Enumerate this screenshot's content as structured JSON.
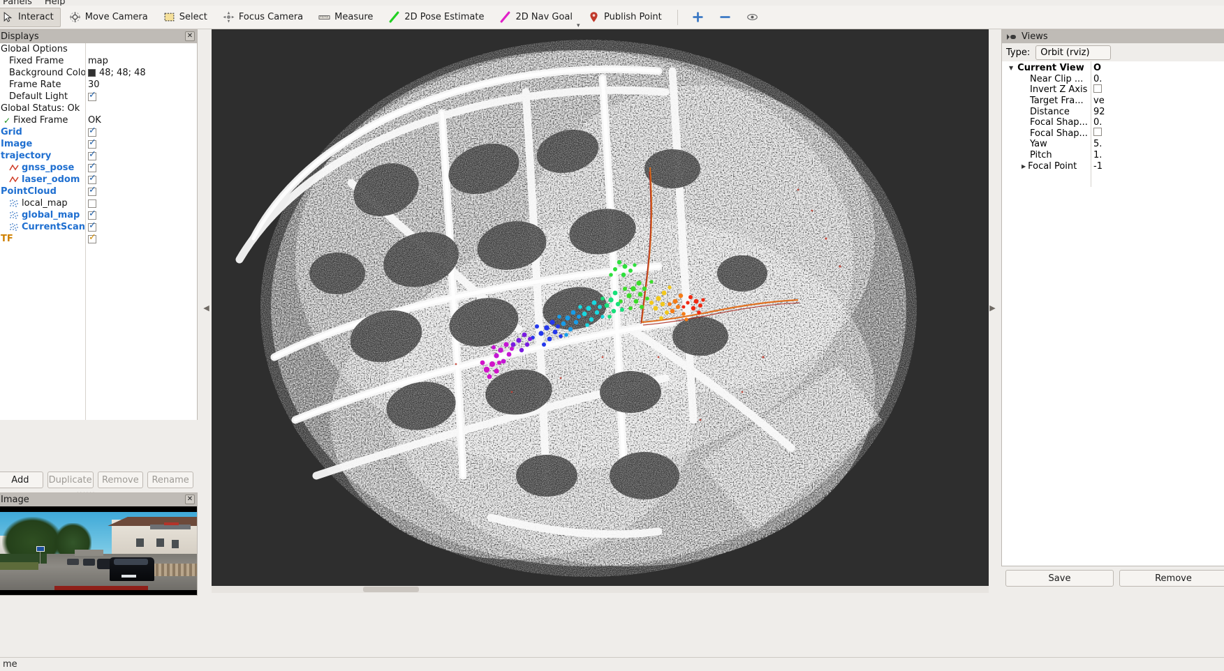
{
  "window": {
    "app": "rviz",
    "menus": [
      {
        "label": "Panels"
      },
      {
        "label": "Help"
      }
    ]
  },
  "toolbar": {
    "items": [
      {
        "label": "Interact",
        "icon": "cursor-icon",
        "active": true
      },
      {
        "label": "Move Camera",
        "icon": "move-camera-icon",
        "active": false
      },
      {
        "label": "Select",
        "icon": "select-icon",
        "active": false
      },
      {
        "label": "Focus Camera",
        "icon": "focus-camera-icon",
        "active": false
      },
      {
        "label": "Measure",
        "icon": "ruler-icon",
        "active": false
      },
      {
        "label": "2D Pose Estimate",
        "icon": "pose-estimate-icon",
        "active": false
      },
      {
        "label": "2D Nav Goal",
        "icon": "nav-goal-icon",
        "active": false
      },
      {
        "label": "Publish Point",
        "icon": "map-pin-icon",
        "active": false
      }
    ],
    "add_tool_label": "+",
    "remove_tool_label": "−",
    "overflow_label": "▾",
    "extra_tool_icon": "eye-icon"
  },
  "displays": {
    "title": "Displays",
    "close_label": "✕",
    "rows": [
      {
        "name": "Global Options",
        "level": 1,
        "style": "plain",
        "value_type": "none"
      },
      {
        "name": "Fixed Frame",
        "level": 2,
        "style": "plain",
        "value_type": "text",
        "value": "map"
      },
      {
        "name": "Background Color",
        "level": 2,
        "style": "plain",
        "value_type": "color",
        "value": "48; 48; 48",
        "color_hex": "#303030"
      },
      {
        "name": "Frame Rate",
        "level": 2,
        "style": "plain",
        "value_type": "text",
        "value": "30"
      },
      {
        "name": "Default Light",
        "level": 2,
        "style": "plain",
        "value_type": "check",
        "checked": true
      },
      {
        "name": "Global Status: Ok",
        "level": 1,
        "style": "plain",
        "value_type": "none"
      },
      {
        "name": "Fixed Frame",
        "level": 2,
        "style": "plain",
        "value_type": "text",
        "value": "OK",
        "status_icon": "green-check-icon"
      },
      {
        "name": "Grid",
        "level": 1,
        "style": "blue",
        "value_type": "check",
        "checked": true
      },
      {
        "name": "Image",
        "level": 1,
        "style": "blue",
        "value_type": "check",
        "checked": true
      },
      {
        "name": "trajectory",
        "level": 1,
        "style": "blue",
        "value_type": "check",
        "checked": true
      },
      {
        "name": "gnss_pose",
        "level": 2,
        "style": "blue",
        "value_type": "check",
        "checked": true,
        "item_icon": "path-icon"
      },
      {
        "name": "laser_odom",
        "level": 2,
        "style": "blue",
        "value_type": "check",
        "checked": true,
        "item_icon": "path-icon"
      },
      {
        "name": "PointCloud",
        "level": 1,
        "style": "blue",
        "value_type": "check",
        "checked": true
      },
      {
        "name": "local_map",
        "level": 2,
        "style": "plain",
        "value_type": "check",
        "checked": false,
        "item_icon": "pointcloud-icon"
      },
      {
        "name": "global_map",
        "level": 2,
        "style": "blue",
        "value_type": "check",
        "checked": true,
        "item_icon": "pointcloud-icon"
      },
      {
        "name": "CurrentScan",
        "level": 2,
        "style": "blue",
        "value_type": "check",
        "checked": true,
        "item_icon": "pointcloud-icon"
      },
      {
        "name": "TF",
        "level": 1,
        "style": "orange",
        "value_type": "check-orange",
        "checked": true
      }
    ],
    "buttons": [
      {
        "label": "Add",
        "enabled": true
      },
      {
        "label": "Duplicate",
        "enabled": false
      },
      {
        "label": "Remove",
        "enabled": false
      },
      {
        "label": "Rename",
        "enabled": false
      }
    ]
  },
  "image_panel": {
    "title": "Image",
    "close_label": "✕",
    "description": "forward-facing camera view of a suburban street with parked cars"
  },
  "views": {
    "title": "Views",
    "icon": "views-icon",
    "type_label": "Type:",
    "type_value": "Orbit (rviz)",
    "zero_label": "O",
    "current_view_label": "Current View",
    "rows": [
      {
        "name": "Near Clip ...",
        "value": "0."
      },
      {
        "name": "Invert Z Axis",
        "value": "",
        "value_type": "check",
        "checked": false
      },
      {
        "name": "Target Fra...",
        "value": "ve"
      },
      {
        "name": "Distance",
        "value": "92"
      },
      {
        "name": "Focal Shap...",
        "value": "0."
      },
      {
        "name": "Focal Shap...",
        "value": "",
        "value_type": "check",
        "checked": false
      },
      {
        "name": "Yaw",
        "value": "5."
      },
      {
        "name": "Pitch",
        "value": "1."
      },
      {
        "name": "Focal Point",
        "value": "-1",
        "expandable": true
      }
    ],
    "buttons": [
      {
        "label": "Save"
      },
      {
        "label": "Remove"
      }
    ]
  },
  "view3d": {
    "background_color": "#2e2e2e",
    "map_color": "#f2f2f2",
    "trajectory_color": "#e06a16",
    "gnss_color": "#cf3b26",
    "scan_colors": [
      "#c000c0",
      "#3018e8",
      "#1878f0",
      "#18d8d8",
      "#30f030",
      "#c8f020",
      "#f0a020",
      "#f03010"
    ]
  },
  "statusbar": {
    "text": "me"
  }
}
